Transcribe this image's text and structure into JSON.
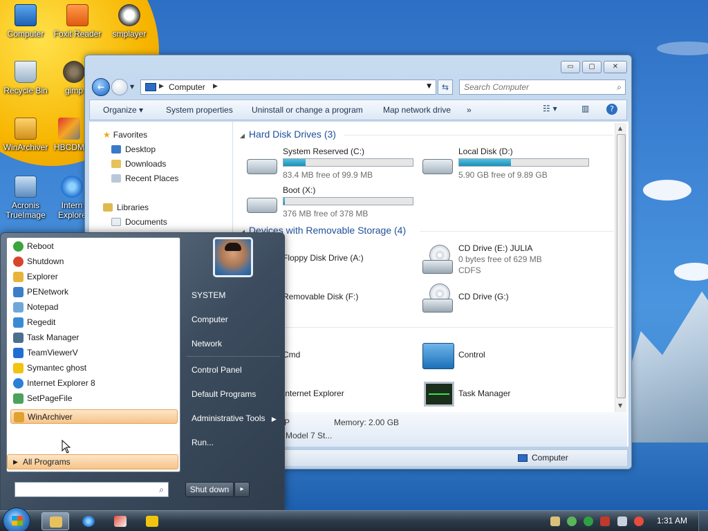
{
  "desktop": {
    "icons": [
      {
        "label": "Computer"
      },
      {
        "label": "Foxit Reader"
      },
      {
        "label": "smplayer"
      },
      {
        "label": "Recycle Bin"
      },
      {
        "label": "gimp"
      },
      {
        "label": "WinArchiver"
      },
      {
        "label": "HBCDM"
      },
      {
        "label": "Acronis"
      },
      {
        "label": "TrueImage"
      },
      {
        "label": "Intern"
      },
      {
        "label": "Explore"
      }
    ]
  },
  "explorer": {
    "controls": {
      "minimize": "▭",
      "maximize": "▢",
      "close": "✕"
    },
    "address": {
      "location": "Computer"
    },
    "search": {
      "placeholder": "Search Computer"
    },
    "commands": {
      "organize": "Organize",
      "system_properties": "System properties",
      "uninstall": "Uninstall or change a program",
      "map_drive": "Map network drive",
      "more": "»"
    },
    "nav": {
      "favorites": "Favorites",
      "desktop": "Desktop",
      "downloads": "Downloads",
      "recent": "Recent Places",
      "libraries": "Libraries",
      "documents": "Documents"
    },
    "groups": {
      "hdd": "Hard Disk Drives (3)",
      "removable": "Devices with Removable Storage (4)",
      "other": ")"
    },
    "drives": [
      {
        "name": "System Reserved (C:)",
        "free": "83.4 MB free of 99.9 MB",
        "used_fraction": 0.17
      },
      {
        "name": "Local Disk (D:)",
        "free": "5.90 GB free of 9.89 GB",
        "used_fraction": 0.4
      },
      {
        "name": "Boot (X:)",
        "free": "376 MB free of 378 MB",
        "used_fraction": 0.01
      }
    ],
    "removable": [
      {
        "name": "Floppy Disk Drive (A:)"
      },
      {
        "name": "CD Drive (E:) JULIA",
        "free": "0 bytes free of 629 MB",
        "fs": "CDFS"
      },
      {
        "name": "Removable Disk (F:)"
      },
      {
        "name": "CD Drive (G:)"
      }
    ],
    "other": [
      {
        "name": "Cmd"
      },
      {
        "name": "Control"
      },
      {
        "name": "Internet Explorer"
      },
      {
        "name": "Task Manager"
      }
    ],
    "details": {
      "p": "P",
      "memory": "Memory: 2.00 GB",
      "model": "Model 7 St..."
    },
    "status": {
      "location": "Computer"
    }
  },
  "start_menu": {
    "programs": [
      {
        "label": "Reboot",
        "color": "#3aa53a"
      },
      {
        "label": "Shutdown",
        "color": "#d9452c"
      },
      {
        "label": "Explorer",
        "color": "#e8b33a"
      },
      {
        "label": "PENetwork",
        "color": "#3c7fc9"
      },
      {
        "label": "Notepad",
        "color": "#6fa7d8"
      },
      {
        "label": "Regedit",
        "color": "#3b8bd3"
      },
      {
        "label": "Task Manager",
        "color": "#4a6f8f"
      },
      {
        "label": "TeamViewerV",
        "color": "#1f6fd1"
      },
      {
        "label": "Symantec ghost",
        "color": "#f1c40f"
      },
      {
        "label": "Internet Explorer 8",
        "color": "#2a7fd6"
      },
      {
        "label": "SetPageFile",
        "color": "#4aa35a"
      },
      {
        "label": "WinArchiver",
        "color": "#e0a22e"
      }
    ],
    "all_programs": "All Programs",
    "right": {
      "system": "SYSTEM",
      "computer": "Computer",
      "network": "Network",
      "control_panel": "Control Panel",
      "default_programs": "Default Programs",
      "admin_tools": "Administrative Tools",
      "run": "Run..."
    },
    "shutdown": "Shut down"
  },
  "taskbar": {
    "clock": "1:31 AM"
  }
}
